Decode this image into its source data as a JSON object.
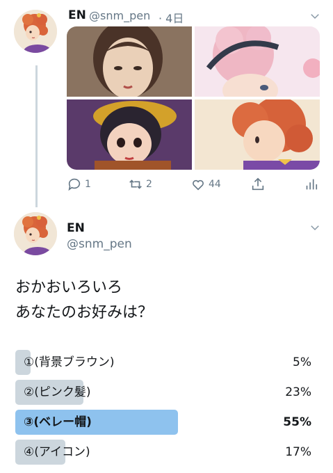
{
  "tweet1": {
    "name": "EN",
    "handle": "@snm_pen",
    "time": "· 4日",
    "actions": {
      "reply_count": "1",
      "retweet_count": "2",
      "like_count": "44"
    }
  },
  "tweet2": {
    "name": "EN",
    "handle": "@snm_pen",
    "text_line1": "おかおいろいろ",
    "text_line2": "あなたのお好みは？",
    "poll": [
      {
        "label": "①(背景ブラウン)",
        "percent": "5%",
        "value": 5,
        "winner": false
      },
      {
        "label": "②(ピンク髪)",
        "percent": "23%",
        "value": 23,
        "winner": false
      },
      {
        "label": "③(ベレー帽)",
        "percent": "55%",
        "value": 55,
        "winner": true
      },
      {
        "label": "④(アイコン)",
        "percent": "17%",
        "value": 17,
        "winner": false
      }
    ]
  },
  "colors": {
    "accent": "#1da1f2",
    "poll_winner": "#8ec2ee",
    "poll_other": "#ccd6dd",
    "muted": "#657786"
  }
}
